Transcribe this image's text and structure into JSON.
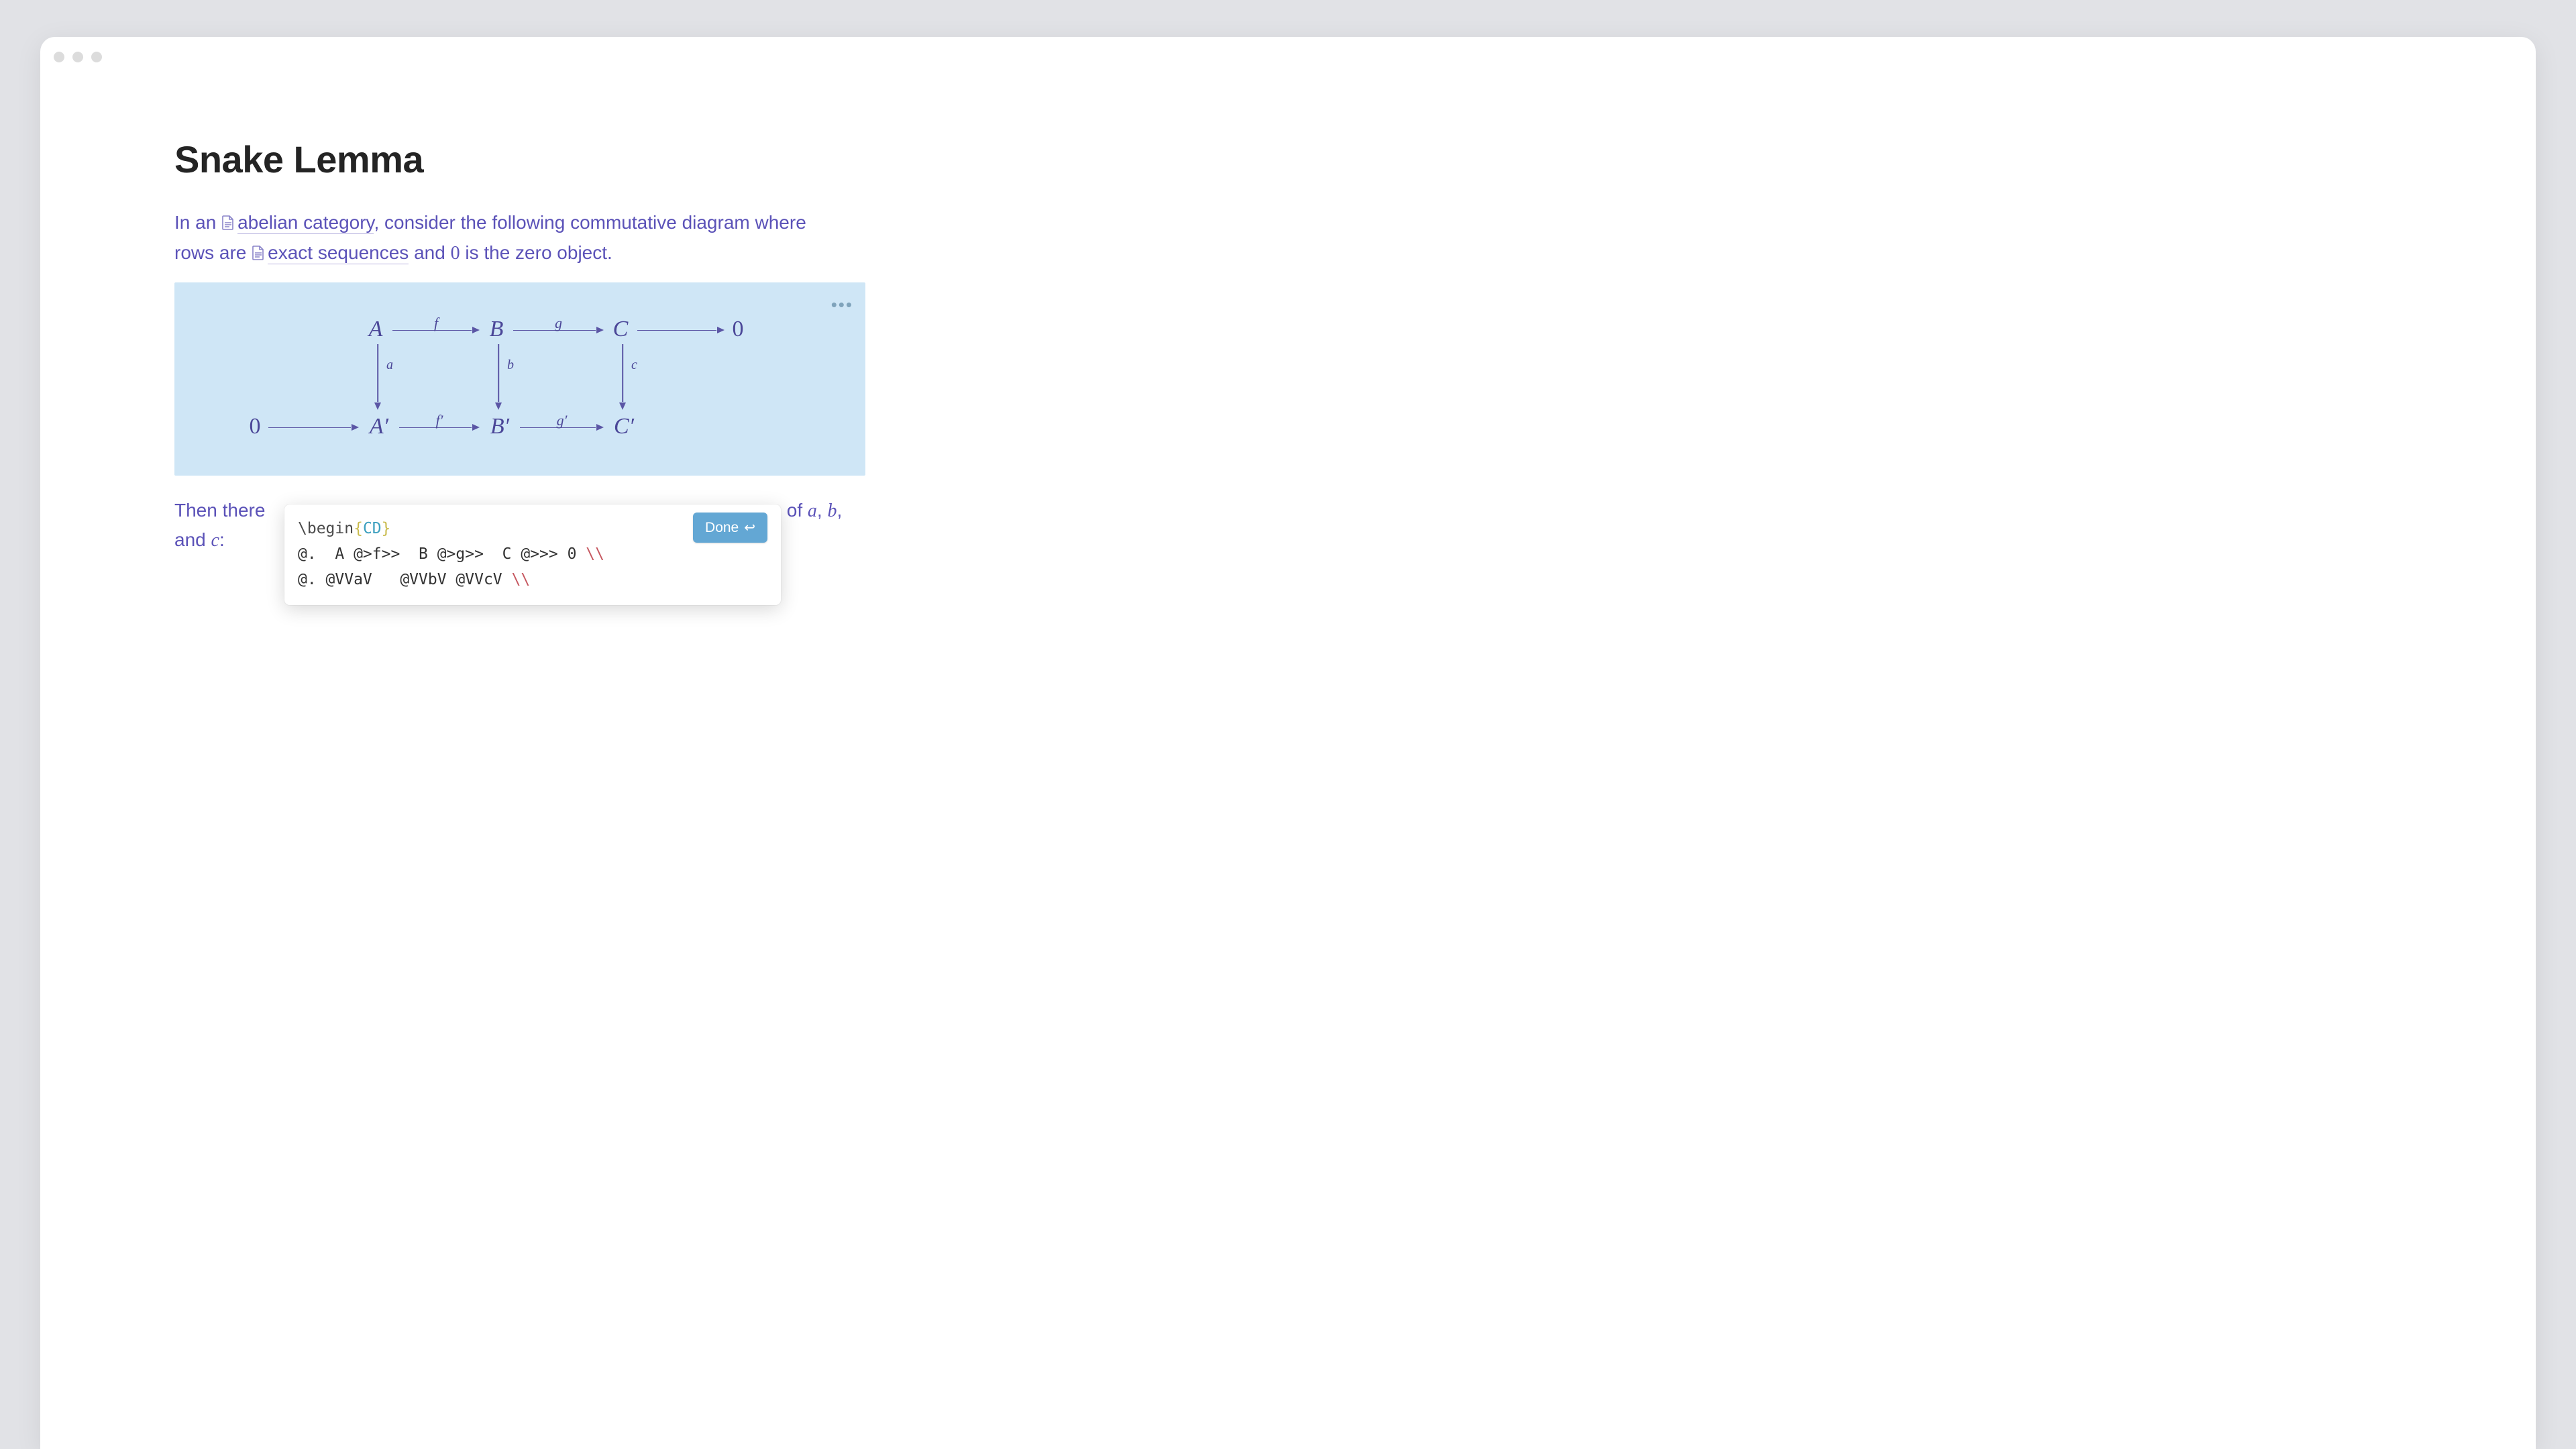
{
  "page": {
    "title": "Snake Lemma",
    "intro": {
      "prefix": "In an ",
      "link1": "abelian category",
      "mid1": ", consider the following commutative diagram where rows are ",
      "link2": "exact sequences",
      "mid2": " and ",
      "zero": "0",
      "suffix": " is the zero object."
    },
    "para2": {
      "prefix": "Then there",
      "suffix": "s of ",
      "var_a": "a",
      "sep1": ", ",
      "var_b": "b",
      "sep2": ", and ",
      "var_c": "c",
      "colon": ":"
    }
  },
  "diagram": {
    "row1": {
      "A": "A",
      "B": "B",
      "C": "C",
      "zero": "0"
    },
    "row2": {
      "zero": "0",
      "A": "A′",
      "B": "B′",
      "C": "C′"
    },
    "top_labels": {
      "f": "f",
      "g": "g"
    },
    "bot_labels": {
      "f": "f′",
      "g": "g′"
    },
    "down_labels": {
      "a": "a",
      "b": "b",
      "c": "c"
    }
  },
  "editor": {
    "done_label": "Done",
    "line1": {
      "begin": "\\begin",
      "lb": "{",
      "env": "CD",
      "rb": "}"
    },
    "line2": {
      "body": "@.  A @>f>>  B @>g>>  C @>>> 0 ",
      "esc": "\\\\"
    },
    "line3": {
      "body": "@. @VVaV   @VVbV @VVcV ",
      "esc": "\\\\"
    }
  }
}
